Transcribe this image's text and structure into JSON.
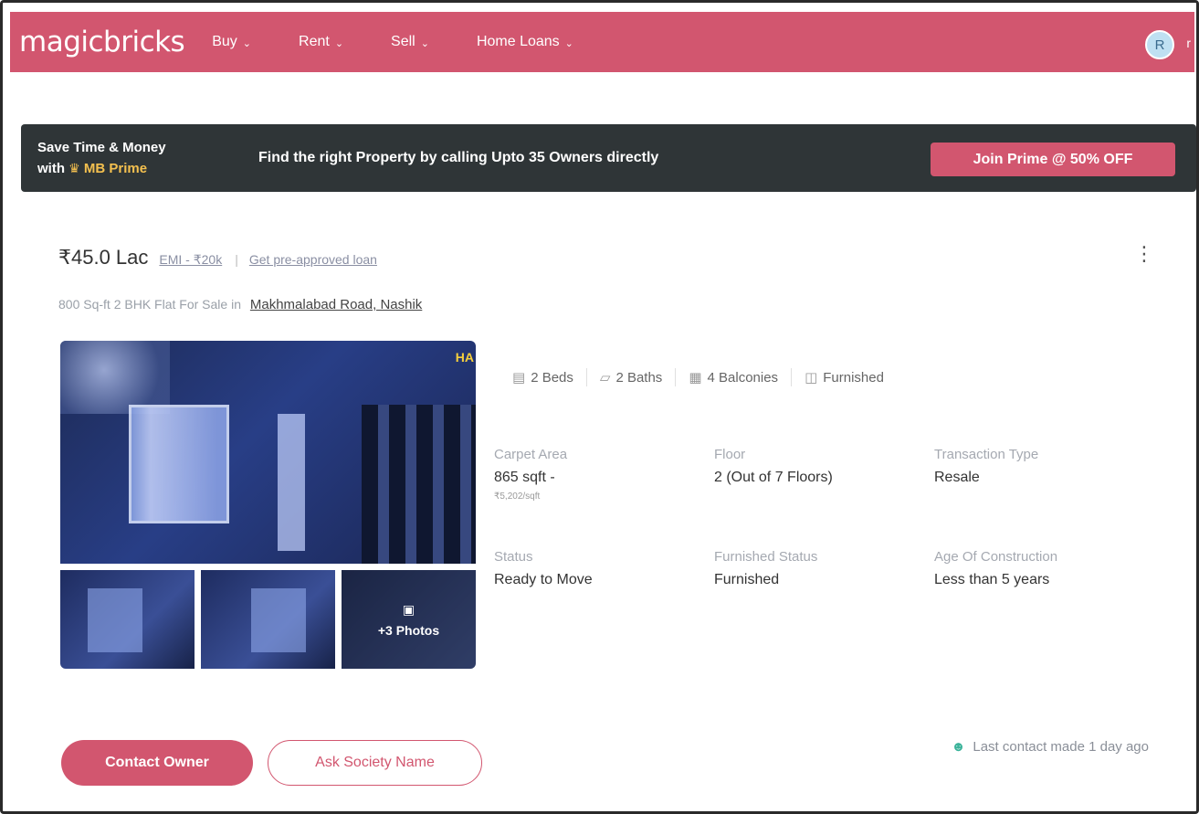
{
  "header": {
    "logo": "magicbricks",
    "nav": [
      {
        "label": "Buy"
      },
      {
        "label": "Rent"
      },
      {
        "label": "Sell"
      },
      {
        "label": "Home Loans"
      }
    ],
    "avatar_initial": "R",
    "avatar_tail": "r",
    "colors": {
      "brand": "#d2566f",
      "avatar_bg": "#bfe0f2"
    }
  },
  "banner": {
    "line1": "Save Time & Money",
    "line2_prefix": "with",
    "line2_brand": "MB Prime",
    "crown_icon": "crown-icon",
    "message": "Find the right Property by calling Upto 35 Owners directly",
    "cta": "Join Prime @ 50% OFF",
    "colors": {
      "bg": "#2f3537",
      "gold": "#f4c04f"
    }
  },
  "listing": {
    "price": "₹45.0 Lac",
    "emi": "EMI - ₹20k",
    "separator": "|",
    "loan_link": "Get pre-approved loan",
    "subtitle": "800 Sq-ft 2 BHK Flat For Sale in",
    "location": "Makhmalabad Road, Nashik",
    "photo_overlay_text": "HA",
    "more_photos": "+3 Photos",
    "features": [
      {
        "icon": "bed-icon",
        "label": "2 Beds"
      },
      {
        "icon": "bath-icon",
        "label": "2 Baths"
      },
      {
        "icon": "balcony-icon",
        "label": "4 Balconies"
      },
      {
        "icon": "furnished-icon",
        "label": "Furnished"
      }
    ],
    "details": {
      "carpet_area": {
        "label": "Carpet Area",
        "value": "865 sqft -",
        "sub": "₹5,202/sqft"
      },
      "floor": {
        "label": "Floor",
        "value": "2 (Out of 7 Floors)"
      },
      "transaction_type": {
        "label": "Transaction Type",
        "value": "Resale"
      },
      "status": {
        "label": "Status",
        "value": "Ready to Move"
      },
      "furnished_status": {
        "label": "Furnished Status",
        "value": "Furnished"
      },
      "age": {
        "label": "Age Of Construction",
        "value": "Less than 5 years"
      }
    },
    "actions": {
      "contact_owner": "Contact Owner",
      "ask_society": "Ask Society Name"
    },
    "last_contact": "Last contact made 1 day ago"
  }
}
